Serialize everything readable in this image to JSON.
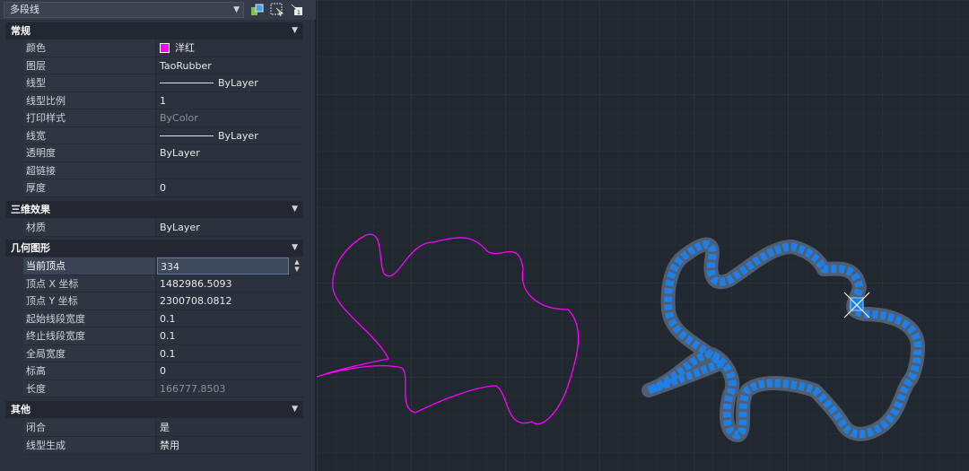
{
  "object_selector": {
    "value": "多段线"
  },
  "toolbar_icons": [
    "quick-select-icon",
    "select-objects-icon",
    "toggle-pickadd-icon"
  ],
  "sections": {
    "general": {
      "title": "常规",
      "rows": [
        {
          "label": "颜色",
          "value": "洋红",
          "swatch": "#ff00ff"
        },
        {
          "label": "图层",
          "value": "TaoRubber"
        },
        {
          "label": "线型",
          "value": "ByLayer"
        },
        {
          "label": "线型比例",
          "value": "1"
        },
        {
          "label": "打印样式",
          "value": "ByColor"
        },
        {
          "label": "线宽",
          "value": "ByLayer"
        },
        {
          "label": "透明度",
          "value": "ByLayer"
        },
        {
          "label": "超链接",
          "value": ""
        },
        {
          "label": "厚度",
          "value": "0"
        }
      ]
    },
    "three_d": {
      "title": "三维效果",
      "rows": [
        {
          "label": "材质",
          "value": "ByLayer"
        }
      ]
    },
    "geometry": {
      "title": "几何图形",
      "rows": [
        {
          "label": "当前顶点",
          "value": "334"
        },
        {
          "label": "顶点 X 坐标",
          "value": "1482986.5093"
        },
        {
          "label": "顶点 Y 坐标",
          "value": "2300708.0812"
        },
        {
          "label": "起始线段宽度",
          "value": "0.1"
        },
        {
          "label": "终止线段宽度",
          "value": "0.1"
        },
        {
          "label": "全局宽度",
          "value": "0.1"
        },
        {
          "label": "标高",
          "value": "0"
        },
        {
          "label": "长度",
          "value": "166777.8503"
        }
      ]
    },
    "misc": {
      "title": "其他",
      "rows": [
        {
          "label": "闭合",
          "value": "是"
        },
        {
          "label": "线型生成",
          "value": "禁用"
        }
      ]
    }
  },
  "colors": {
    "magenta_polyline": "#ff00ff",
    "selected_polyline": "#1e7fe6",
    "grip_highlight": "#ffffff"
  }
}
